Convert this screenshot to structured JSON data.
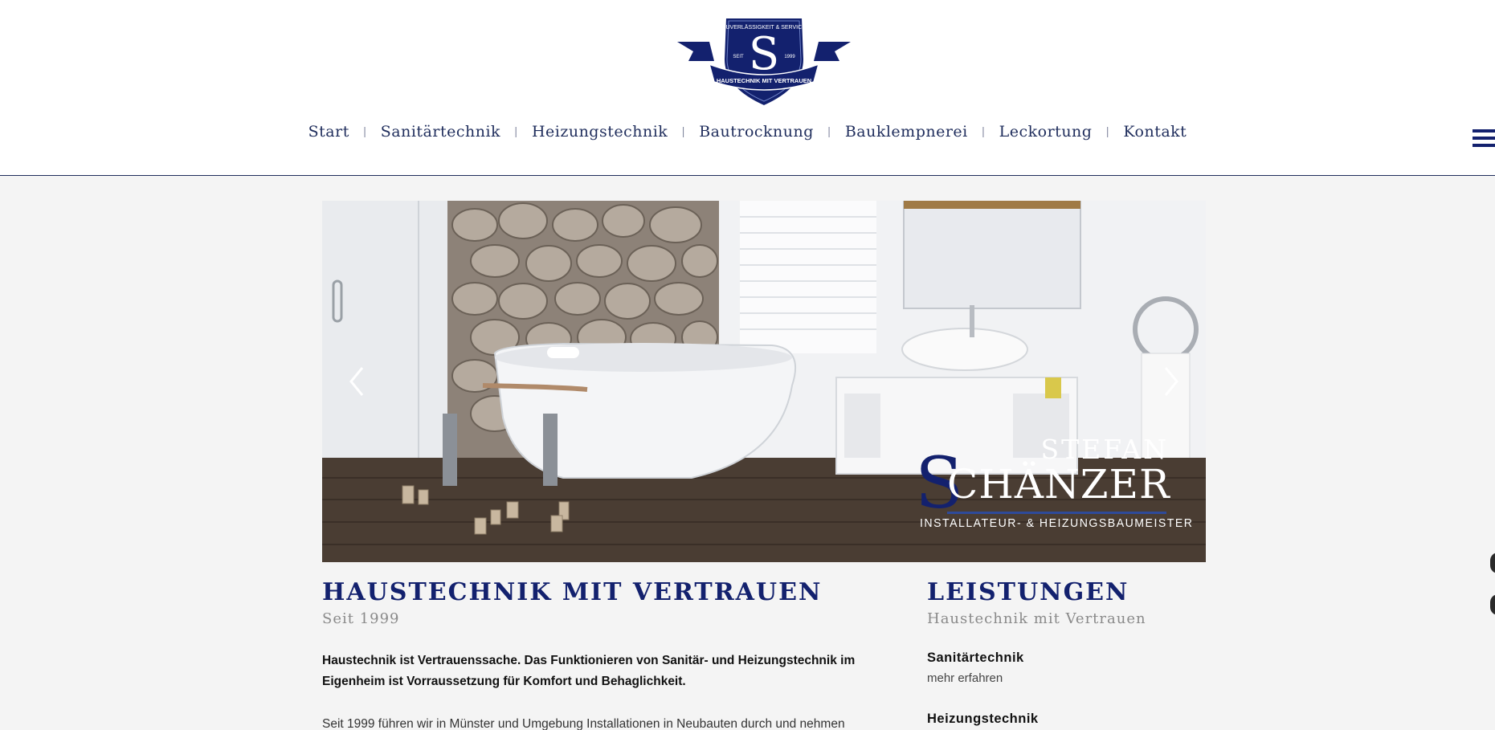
{
  "logo": {
    "arc_text": "ZUVERLÄSSIGKEIT & SERVICE",
    "letter": "S",
    "left_text": "SEIT",
    "right_text": "1999",
    "banner_text": "HAUSTECHNIK MIT VERTRAUEN"
  },
  "nav": {
    "items": [
      "Start",
      "Sanitärtechnik",
      "Heizungstechnik",
      "Bautrocknung",
      "Bauklempnerei",
      "Leckortung",
      "Kontakt"
    ],
    "separator": "|"
  },
  "hero": {
    "brand_first": "STEFAN",
    "brand_initial": "S",
    "brand_last": "CHÄNZER",
    "brand_subtitle": "INSTALLATEUR- & HEIZUNGSBAUMEISTER"
  },
  "main": {
    "title": "HAUSTECHNIK MIT VERTRAUEN",
    "subtitle": "Seit 1999",
    "intro_bold": "Haustechnik ist Vertrauenssache. Das Funktionieren von Sanitär- und Heizungstechnik im Eigenheim ist Vorraussetzung für Komfort und Behaglichkeit.",
    "intro_text": "Seit 1999 führen wir in Münster und Umgebung Installationen in Neubauten durch und nehmen"
  },
  "sidebar": {
    "title": "LEISTUNGEN",
    "subtitle": "Haustechnik mit Vertrauen",
    "services": [
      {
        "name": "Sanitärtechnik",
        "link": "mehr erfahren"
      },
      {
        "name": "Heizungstechnik"
      }
    ]
  },
  "colors": {
    "brand_blue": "#13216e",
    "nav_text": "#1f2d5c",
    "background": "#f4f4f4"
  }
}
